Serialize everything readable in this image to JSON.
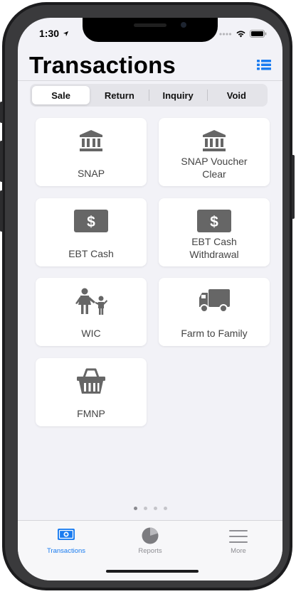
{
  "status": {
    "time": "1:30"
  },
  "header": {
    "title": "Transactions"
  },
  "segments": [
    {
      "label": "Sale",
      "active": true
    },
    {
      "label": "Return",
      "active": false
    },
    {
      "label": "Inquiry",
      "active": false
    },
    {
      "label": "Void",
      "active": false
    }
  ],
  "tiles": [
    {
      "label": "SNAP",
      "icon": "bank-icon"
    },
    {
      "label": "SNAP Voucher\nClear",
      "icon": "bank-icon"
    },
    {
      "label": "EBT Cash",
      "icon": "dollar-icon"
    },
    {
      "label": "EBT Cash\nWithdrawal",
      "icon": "dollar-icon"
    },
    {
      "label": "WIC",
      "icon": "mother-child-icon"
    },
    {
      "label": "Farm to Family",
      "icon": "truck-icon"
    },
    {
      "label": "FMNP",
      "icon": "basket-icon"
    }
  ],
  "tabbar": {
    "items": [
      {
        "label": "Transactions",
        "icon": "cash-icon",
        "active": true
      },
      {
        "label": "Reports",
        "icon": "pie-chart-icon",
        "active": false
      },
      {
        "label": "More",
        "icon": "menu-icon",
        "active": false
      }
    ]
  },
  "page_indicator": {
    "count": 4,
    "current": 1
  },
  "colors": {
    "accent": "#1a7cf0",
    "tile_icon": "#666666",
    "background": "#f2f2f7"
  }
}
